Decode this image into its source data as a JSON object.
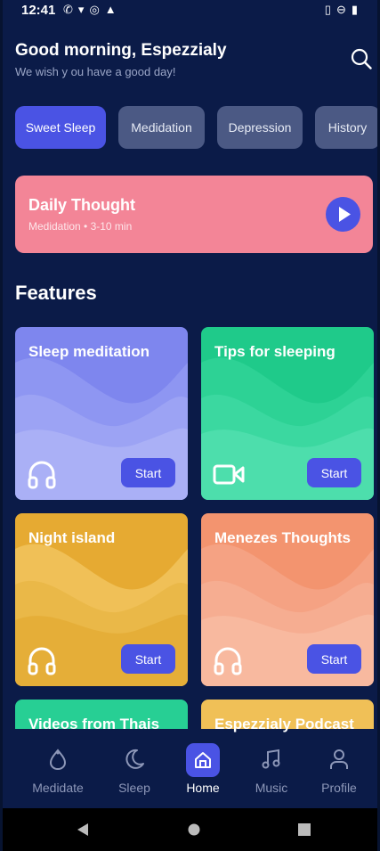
{
  "status_bar": {
    "time": "12:41",
    "left_icons": [
      "notification-icon",
      "wifi-off-icon",
      "vpn-icon",
      "warning-icon"
    ],
    "right_icons": [
      "vibrate-icon",
      "dnd-icon",
      "battery-icon"
    ]
  },
  "header": {
    "greeting": "Good morning, Espezzialy",
    "subtitle": "We wish y ou have a good day!",
    "search_icon": "search-icon"
  },
  "chips": [
    {
      "label": "Sweet Sleep",
      "active": true
    },
    {
      "label": "Medidation",
      "active": false
    },
    {
      "label": "Depression",
      "active": false
    },
    {
      "label": "History",
      "active": false
    }
  ],
  "daily_thought": {
    "title": "Daily Thought",
    "subtitle": "Medidation • 3-10 min",
    "color": "#f38597",
    "play_icon": "play-icon"
  },
  "features": {
    "heading": "Features",
    "cards": [
      {
        "title": "Sleep meditation",
        "icon": "headphones-icon",
        "button": "Start",
        "color": "#8b93f1"
      },
      {
        "title": "Tips for sleeping",
        "icon": "video-icon",
        "button": "Start",
        "color": "#27cf94"
      },
      {
        "title": "Night island",
        "icon": "headphones-icon",
        "button": "Start",
        "color": "#f0c057"
      },
      {
        "title": "Menezes Thoughts",
        "icon": "headphones-icon",
        "button": "Start",
        "color": "#f59b7e"
      },
      {
        "title": "Videos from Thais",
        "color": "#27cf94"
      },
      {
        "title": "Espezzialy Podcast",
        "color": "#f0c057"
      }
    ]
  },
  "bottom_nav": [
    {
      "label": "Medidate",
      "icon": "meditate-icon",
      "active": false
    },
    {
      "label": "Sleep",
      "icon": "moon-icon",
      "active": false
    },
    {
      "label": "Home",
      "icon": "home-icon",
      "active": true
    },
    {
      "label": "Music",
      "icon": "music-icon",
      "active": false
    },
    {
      "label": "Profile",
      "icon": "profile-icon",
      "active": false
    }
  ],
  "accent": "#4a53e4",
  "background": "#0b1b48"
}
